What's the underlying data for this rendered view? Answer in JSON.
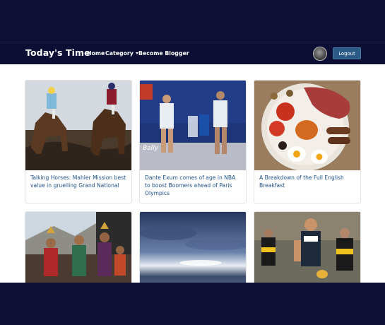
{
  "navbar": {
    "brand": "Today's Time",
    "links": {
      "home": "Home",
      "category": "Category",
      "become_blogger": "Become Blogger"
    },
    "logout_label": "Logout"
  },
  "articles": [
    {
      "title": "Talking Horses: Mahler Mission best value in gruelling Grand National"
    },
    {
      "title": "Dante Exum comes of age in NBA to boost Boomers ahead of Paris Olympics"
    },
    {
      "title": "A Breakdown of the Full English Breakfast"
    },
    {
      "title": ""
    },
    {
      "title": ""
    },
    {
      "title": ""
    }
  ],
  "colors": {
    "navbar": "#0c0f33",
    "backdrop": "#0f1035",
    "logout_button": "#2c5a86",
    "link_text": "#1b4f8a"
  }
}
